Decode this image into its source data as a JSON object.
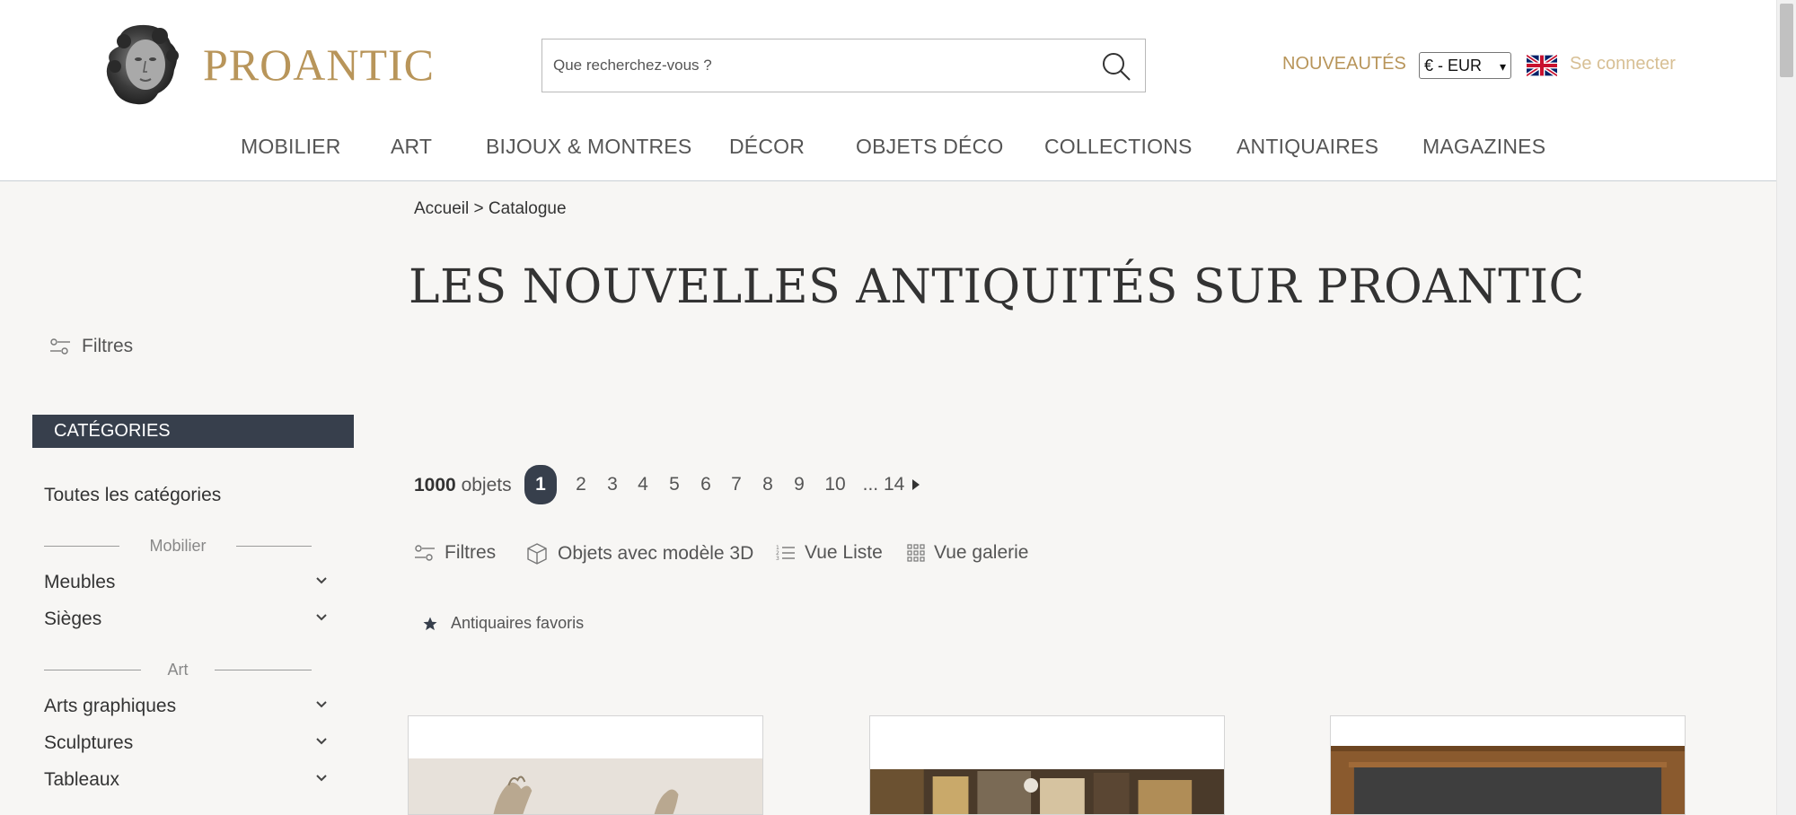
{
  "header": {
    "logo_text": "PROANTIC",
    "search_placeholder": "Que recherchez-vous ?",
    "nouveautes": "NOUVEAUTÉS",
    "currency": "€ - EUR",
    "login": "Se connecter",
    "colors": {
      "gold": "#b8955a",
      "dark": "#373f4c"
    }
  },
  "nav": [
    "MOBILIER",
    "ART",
    "BIJOUX & MONTRES",
    "DÉCOR",
    "OBJETS DÉCO",
    "COLLECTIONS",
    "ANTIQUAIRES",
    "MAGAZINES"
  ],
  "breadcrumb": {
    "home": "Accueil",
    "sep": ">",
    "current": "Catalogue"
  },
  "page_title": "LES NOUVELLES ANTIQUITÉS SUR PROANTIC",
  "sidebar": {
    "filters_label": "Filtres",
    "categories_title": "CATÉGORIES",
    "all_categories": "Toutes les catégories",
    "groups": [
      {
        "label": "Mobilier",
        "items": [
          "Meubles",
          "Sièges"
        ]
      },
      {
        "label": "Art",
        "items": [
          "Arts graphiques",
          "Sculptures",
          "Tableaux"
        ]
      }
    ]
  },
  "listing": {
    "count_number": "1000",
    "count_label": "objets",
    "pages": [
      "1",
      "2",
      "3",
      "4",
      "5",
      "6",
      "7",
      "8",
      "9",
      "10",
      "... 14"
    ],
    "active_page": "1",
    "toolbar": {
      "filters": "Filtres",
      "objects_3d": "Objets avec modèle 3D",
      "list_view": "Vue Liste",
      "gallery_view": "Vue galerie"
    },
    "favorites": "Antiquaires favoris"
  }
}
